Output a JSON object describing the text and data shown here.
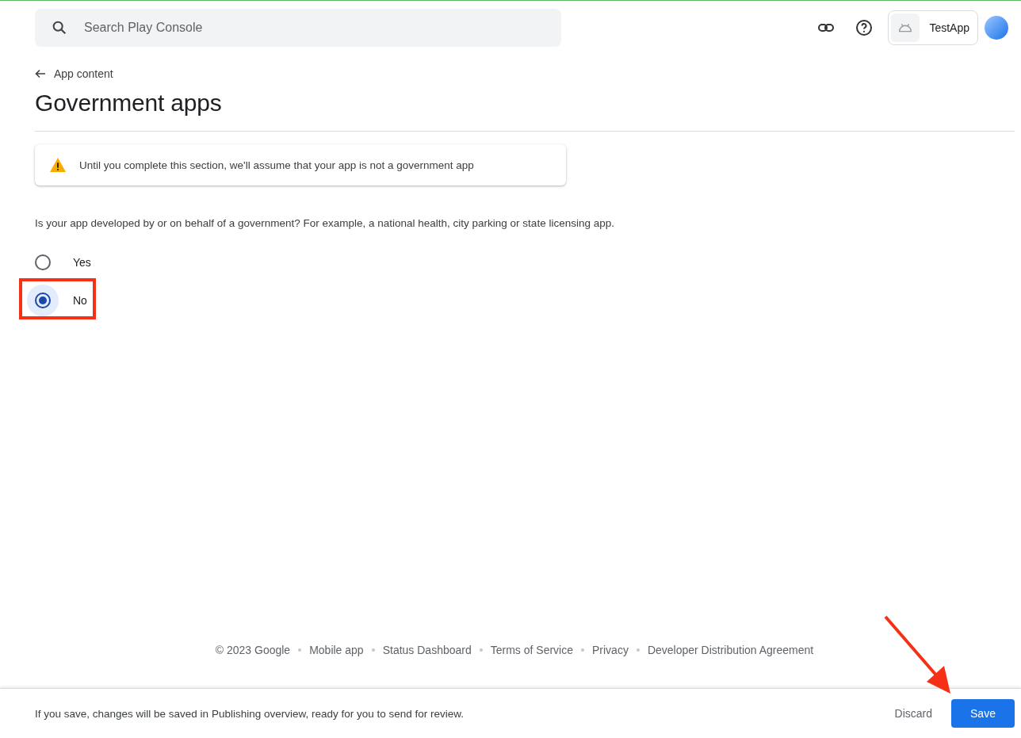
{
  "search": {
    "placeholder": "Search Play Console"
  },
  "app_chip": {
    "name": "TestApp"
  },
  "breadcrumb": {
    "label": "App content"
  },
  "title": "Government apps",
  "notice": {
    "text": "Until you complete this section, we'll assume that your app is not a government app"
  },
  "question": "Is your app developed by or on behalf of a government? For example, a national health, city parking or state licensing app.",
  "options": [
    {
      "label": "Yes",
      "selected": false,
      "highlighted": false
    },
    {
      "label": "No",
      "selected": true,
      "highlighted": true
    }
  ],
  "footer_links": [
    "© 2023 Google",
    "Mobile app",
    "Status Dashboard",
    "Terms of Service",
    "Privacy",
    "Developer Distribution Agreement"
  ],
  "save_bar": {
    "message": "If you save, changes will be saved in Publishing overview, ready for you to send for review.",
    "discard": "Discard",
    "save": "Save",
    "arrow_to_save": true
  }
}
